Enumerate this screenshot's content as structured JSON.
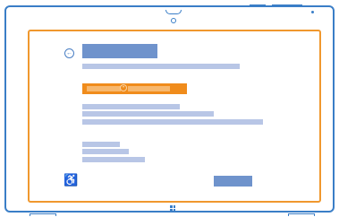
{
  "device": {
    "accent": "#3a7ec7"
  },
  "screen": {
    "accent": "#f0982e",
    "back_icon": "back-arrow-icon",
    "ease_of_access_icon": "ease-of-access-icon",
    "code_icon": "pin-icon"
  },
  "taskbar": {
    "windows_icon": "windows-logo-icon"
  }
}
